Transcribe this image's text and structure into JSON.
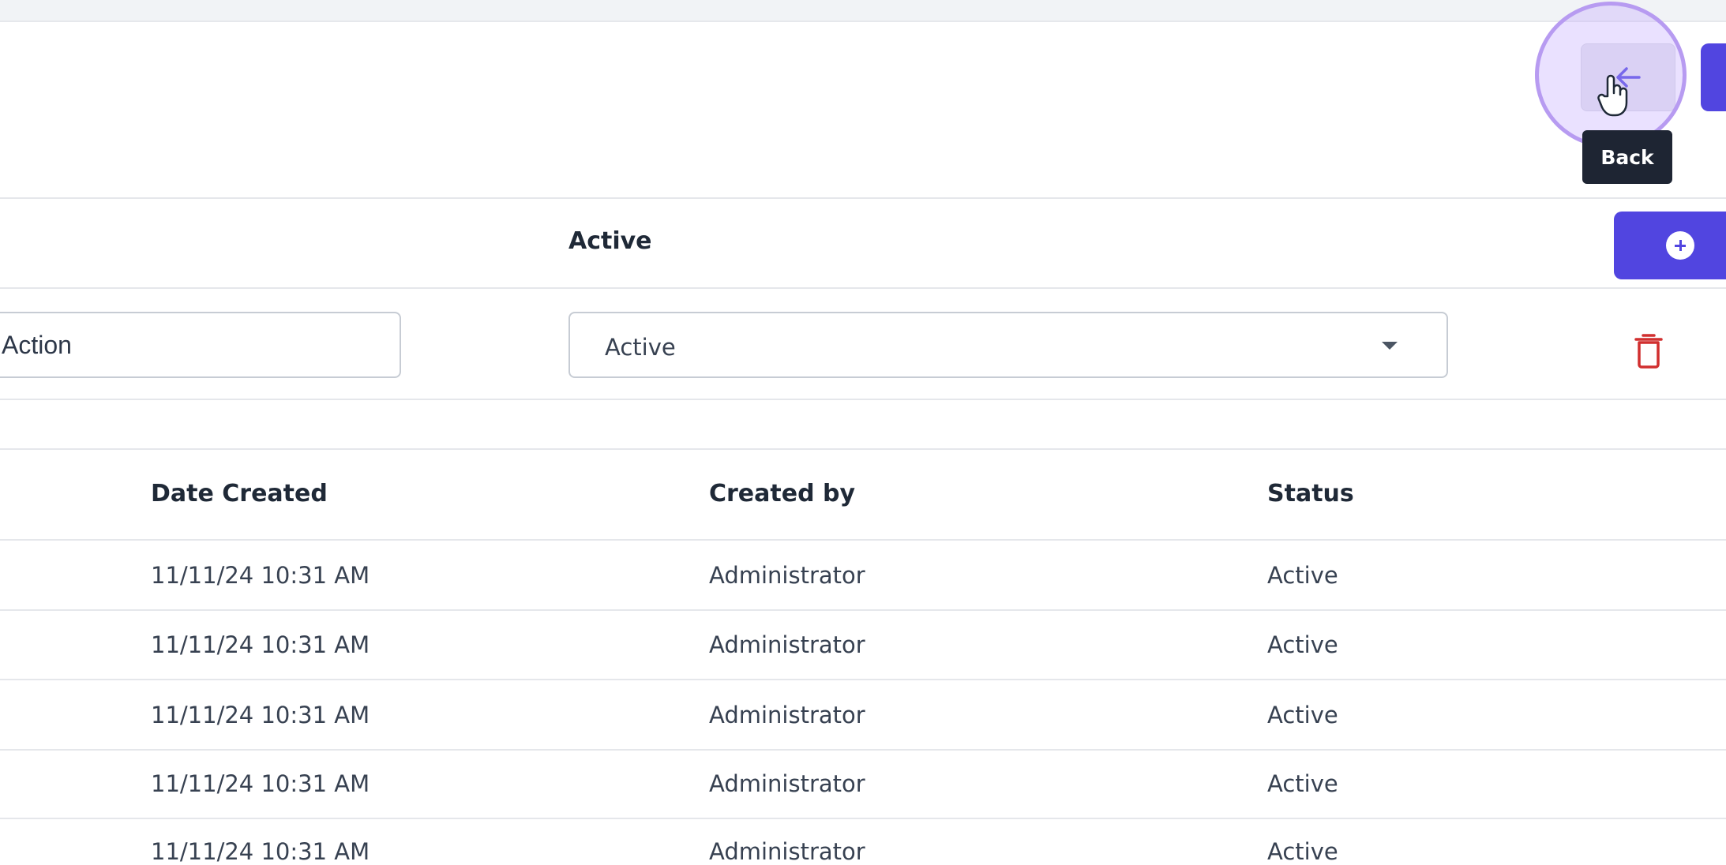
{
  "header": {
    "back_tooltip": "Back"
  },
  "form": {
    "status_label": "Active",
    "action_value": "Action",
    "status_selected": "Active"
  },
  "table": {
    "columns": [
      "Date Created",
      "Created by",
      "Status"
    ],
    "rows": [
      {
        "date": "11/11/24 10:31 AM",
        "created_by": "Administrator",
        "status": "Active"
      },
      {
        "date": "11/11/24 10:31 AM",
        "created_by": "Administrator",
        "status": "Active"
      },
      {
        "date": "11/11/24 10:31 AM",
        "created_by": "Administrator",
        "status": "Active"
      },
      {
        "date": "11/11/24 10:31 AM",
        "created_by": "Administrator",
        "status": "Active"
      },
      {
        "date": "11/11/24 10:31 AM",
        "created_by": "Administrator",
        "status": "Active"
      }
    ]
  },
  "colors": {
    "primary": "#5145e0",
    "danger": "#d12f2f",
    "tooltip_bg": "#1e2533",
    "cursor_highlight": "#b79bf1"
  },
  "icons": {
    "back": "arrow-left-icon",
    "add": "plus-circle-icon",
    "delete": "trash-icon",
    "dropdown": "caret-down-icon",
    "cursor": "hand-pointer-icon"
  }
}
